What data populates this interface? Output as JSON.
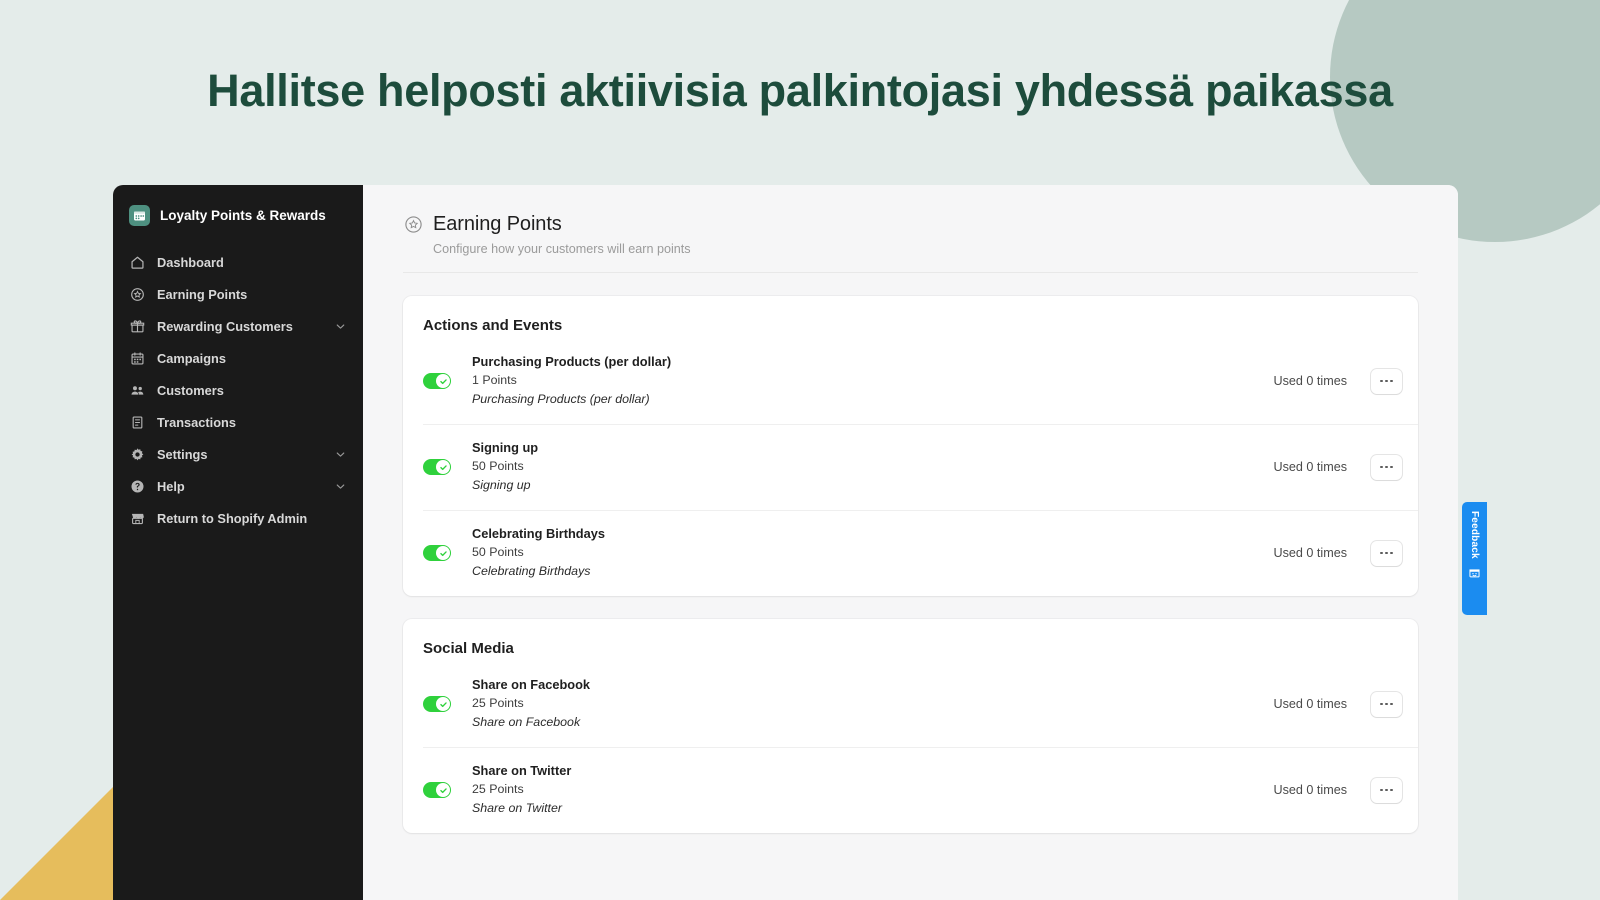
{
  "hero": {
    "title": "Hallitse helposti aktiivisia palkintojasi yhdessä paikassa",
    "title_color": "#1d4c3c"
  },
  "decor": {
    "page_background": "#e4ecea",
    "circle_color": "#b6c9c2",
    "triangle_color": "#e6bd5c"
  },
  "sidebar": {
    "brand": {
      "name": "Loyalty Points & Rewards",
      "logo_icon": "app-grid-icon",
      "logo_color": "#4e9080"
    },
    "items": [
      {
        "label": "Dashboard",
        "icon": "home-icon",
        "expandable": false
      },
      {
        "label": "Earning Points",
        "icon": "star-circle-icon",
        "expandable": false
      },
      {
        "label": "Rewarding Customers",
        "icon": "gift-icon",
        "expandable": true
      },
      {
        "label": "Campaigns",
        "icon": "calendar-icon",
        "expandable": false
      },
      {
        "label": "Customers",
        "icon": "people-icon",
        "expandable": false
      },
      {
        "label": "Transactions",
        "icon": "receipt-icon",
        "expandable": false
      },
      {
        "label": "Settings",
        "icon": "gear-icon",
        "expandable": true
      },
      {
        "label": "Help",
        "icon": "question-circle-icon",
        "expandable": true
      },
      {
        "label": "Return to Shopify Admin",
        "icon": "store-icon",
        "expandable": false
      }
    ]
  },
  "page": {
    "title": "Earning Points",
    "title_icon": "star-circle-icon",
    "subtitle": "Configure how your customers will earn points"
  },
  "cards": [
    {
      "title": "Actions and Events",
      "rows": [
        {
          "name": "Purchasing Products (per dollar)",
          "points": "1 Points",
          "description": "Purchasing Products (per dollar)",
          "used": "Used 0 times",
          "enabled": true
        },
        {
          "name": "Signing up",
          "points": "50 Points",
          "description": "Signing up",
          "used": "Used 0 times",
          "enabled": true
        },
        {
          "name": "Celebrating Birthdays",
          "points": "50 Points",
          "description": "Celebrating Birthdays",
          "used": "Used 0 times",
          "enabled": true
        }
      ]
    },
    {
      "title": "Social Media",
      "rows": [
        {
          "name": "Share on Facebook",
          "points": "25 Points",
          "description": "Share on Facebook",
          "used": "Used 0 times",
          "enabled": true
        },
        {
          "name": "Share on Twitter",
          "points": "25 Points",
          "description": "Share on Twitter",
          "used": "Used 0 times",
          "enabled": true
        }
      ]
    }
  ],
  "feedback": {
    "label": "Feedback",
    "icon": "smiley-icon",
    "color": "#1b8cf0"
  },
  "toggle": {
    "on_color": "#2fd13c",
    "knob_icon": "check-icon"
  }
}
